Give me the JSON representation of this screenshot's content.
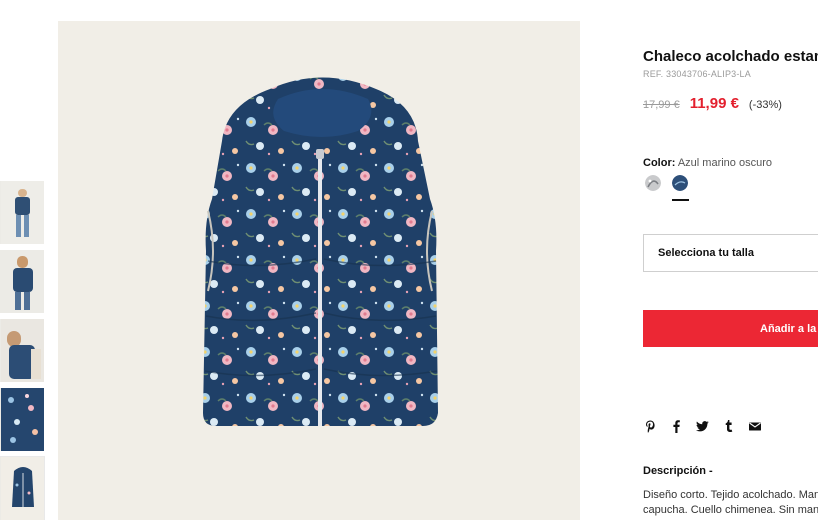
{
  "product": {
    "title": "Chaleco acolchado estampado",
    "ref": "REF. 33043706-ALIP3-LA",
    "old_price": "17,99 €",
    "new_price": "11,99 €",
    "discount": "(-33%)"
  },
  "color": {
    "label": "Color:",
    "value": "Azul marino oscuro",
    "swatches": [
      {
        "name": "floral-gris",
        "color": "#bfc0c3"
      },
      {
        "name": "azul-marino-oscuro",
        "color": "#2d4f79",
        "selected": true
      }
    ]
  },
  "size": {
    "placeholder": "Selecciona tu talla"
  },
  "add_to_cart": {
    "label": "Añadir a la cesta"
  },
  "share": {
    "icons": [
      "pinterest-icon",
      "facebook-icon",
      "twitter-icon",
      "tumblr-icon",
      "email-icon"
    ]
  },
  "description": {
    "title": "Descripción -",
    "line1": "Diseño corto. Tejido acolchado. Manga sisa.",
    "line2": "capucha. Cuello chimenea. Sin mangas."
  },
  "colors": {
    "accent": "#ec2734",
    "price_red": "#e3202e",
    "vest_navy": "#1e3f64"
  }
}
